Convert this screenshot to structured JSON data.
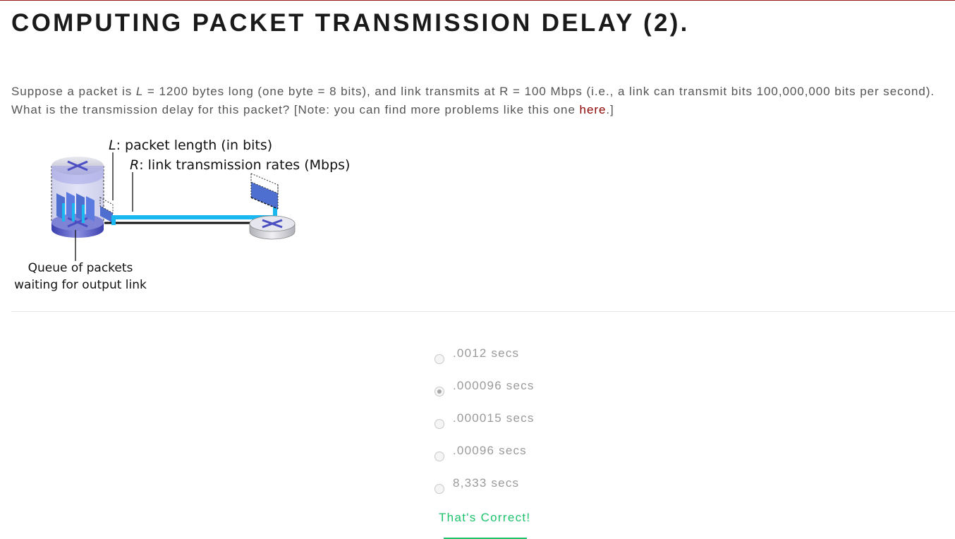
{
  "page": {
    "title": "COMPUTING PACKET TRANSMISSION DELAY (2).",
    "accent_color": "#9b1c1c"
  },
  "problem": {
    "part1": "Suppose a packet is ",
    "var_L": "L",
    "part2": " = 1200 bytes long (one byte = 8 bits), and link transmits at R = 100 Mbps (i.e., a link can transmit bits 100,000,000 bits per second).  What is the transmission delay for this packet? [Note: you can find more problems like this one ",
    "link_text": "here",
    "part3": ".]",
    "link_color": "#8b0000"
  },
  "diagram": {
    "label_L_var": "L",
    "label_L_text": ": packet length (in bits)",
    "label_R_var": "R",
    "label_R_text": ": link transmission rates (Mbps)",
    "queue_label_line1": "Queue of packets",
    "queue_label_line2": "waiting for output link",
    "icons": [
      "router-icon",
      "router-icon"
    ],
    "link_color": "#1ab8f0"
  },
  "quiz": {
    "options": [
      {
        "label": ".0012 secs",
        "selected": false
      },
      {
        "label": ".000096 secs",
        "selected": true
      },
      {
        "label": ".000015 secs",
        "selected": false
      },
      {
        "label": ".00096 secs",
        "selected": false
      },
      {
        "label": "8,333 secs",
        "selected": false
      }
    ],
    "feedback": "That's Correct!",
    "feedback_color": "#1cc36b"
  }
}
